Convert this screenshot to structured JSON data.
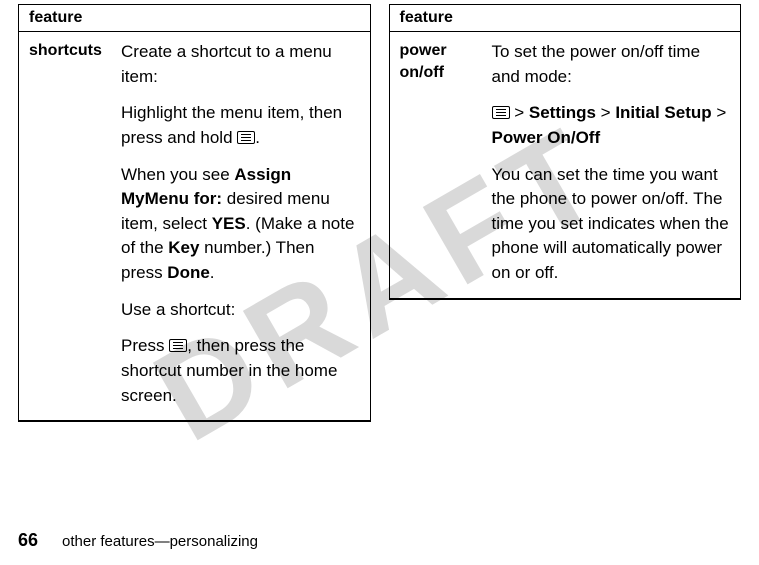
{
  "watermark": "DRAFT",
  "left": {
    "header": "feature",
    "label": "shortcuts",
    "p1": "Create a shortcut to a menu item:",
    "p2a": "Highlight the menu item, then press and hold ",
    "p2b": ".",
    "p3a": "When you see ",
    "p3b": "Assign MyMenu for:",
    "p3c": " desired menu item, select ",
    "p3d": "YES",
    "p3e": ". (Make a note of the ",
    "p3f": "Key",
    "p3g": " number.) Then press ",
    "p3h": "Done",
    "p3i": ".",
    "p4": "Use a shortcut:",
    "p5a": "Press ",
    "p5b": ", then press the shortcut number in the home screen."
  },
  "right": {
    "header": "feature",
    "label": "power on/off",
    "p1": "To set the power on/off time and mode:",
    "p2b": " > ",
    "p2c": "Settings",
    "p2d": " > ",
    "p2e": "Initial Setup",
    "p2f": " > ",
    "p2g": "Power On/Off",
    "p3": "You can set the time you want the phone to power on/off. The time you set indicates when the phone will automatically power on or off."
  },
  "footer": {
    "page": "66",
    "text": "other features—personalizing"
  }
}
